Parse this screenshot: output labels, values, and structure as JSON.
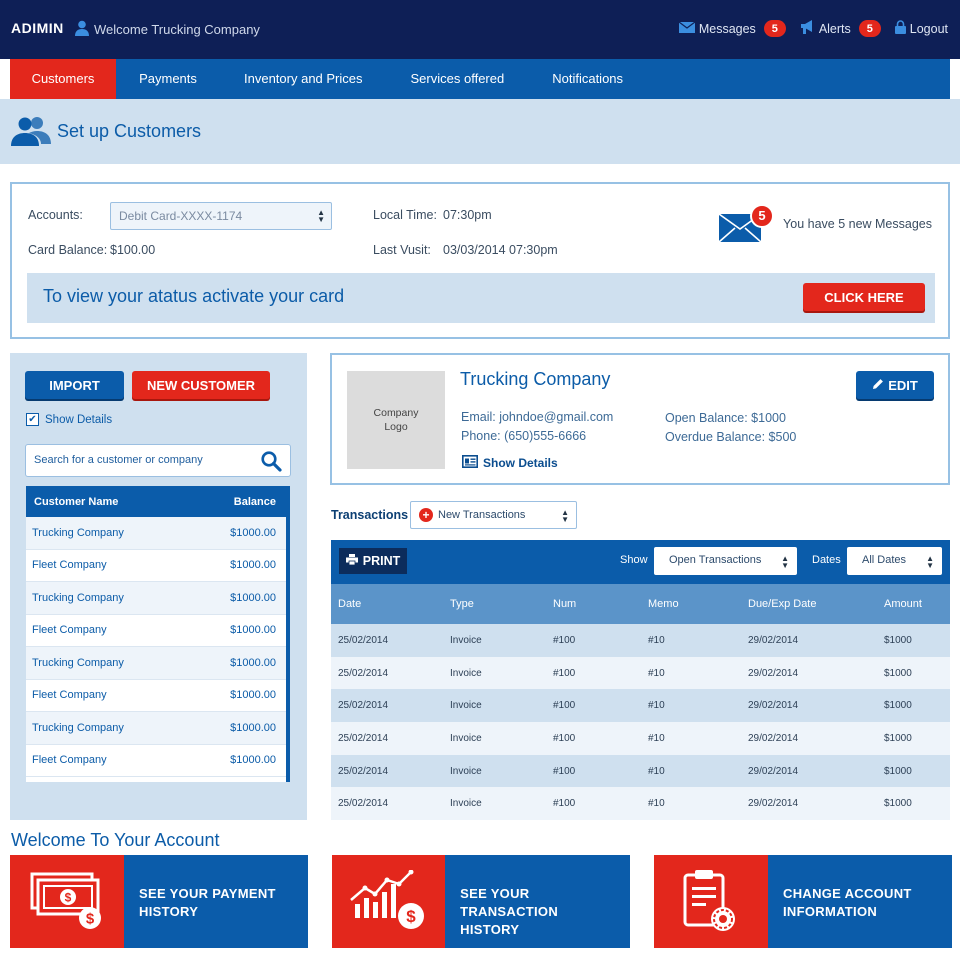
{
  "header": {
    "brand": "ADIMIN",
    "welcome": "Welcome Trucking Company",
    "messages_label": "Messages",
    "messages_count": "5",
    "alerts_label": "Alerts",
    "alerts_count": "5",
    "logout_label": "Logout"
  },
  "nav": {
    "items": [
      {
        "label": "Customers"
      },
      {
        "label": "Payments"
      },
      {
        "label": "Inventory and Prices"
      },
      {
        "label": "Services offered"
      },
      {
        "label": "Notifications"
      }
    ]
  },
  "page": {
    "title": "Set up Customers"
  },
  "account": {
    "accounts_label": "Accounts:",
    "accounts_value": "Debit Card-XXXX-1174",
    "balance_label": "Card Balance:",
    "balance_value": "$100.00",
    "local_time_label": "Local Time:",
    "local_time_value": "07:30pm",
    "last_visit_label": "Last Vusit:",
    "last_visit_value": "03/03/2014 07:30pm",
    "msg_count": "5",
    "msg_text": "You have 5 new Messages",
    "activate_text": "To view your atatus activate your card",
    "click_here": "CLICK HERE"
  },
  "customers": {
    "import_label": "IMPORT",
    "new_label": "NEW CUSTOMER",
    "show_details": "Show Details",
    "search_placeholder": "Search for a customer or company",
    "col_name": "Customer Name",
    "col_balance": "Balance",
    "rows": [
      {
        "name": "Trucking Company",
        "balance": "$1000.00"
      },
      {
        "name": "Fleet Company",
        "balance": "$1000.00"
      },
      {
        "name": "Trucking Company",
        "balance": "$1000.00"
      },
      {
        "name": "Fleet Company",
        "balance": "$1000.00"
      },
      {
        "name": "Trucking Company",
        "balance": "$1000.00"
      },
      {
        "name": "Fleet Company",
        "balance": "$1000.00"
      },
      {
        "name": "Trucking Company",
        "balance": "$1000.00"
      },
      {
        "name": "Fleet Company",
        "balance": "$1000.00"
      }
    ]
  },
  "company": {
    "logo_line1": "Company",
    "logo_line2": "Logo",
    "name": "Trucking Company",
    "email": "Email: johndoe@gmail.com",
    "phone": "Phone: (650)555-6666",
    "open_balance": "Open Balance: $1000",
    "overdue_balance": "Overdue Balance: $500",
    "show_details": "Show Details",
    "edit_label": "EDIT"
  },
  "transactions": {
    "label": "Transactions",
    "new_label": "New Transactions",
    "print_label": "PRINT",
    "show_label": "Show",
    "show_value": "Open Transactions",
    "dates_label": "Dates",
    "dates_value": "All Dates",
    "columns": [
      "Date",
      "Type",
      "Num",
      "Memo",
      "Due/Exp Date",
      "Amount"
    ],
    "rows": [
      [
        "25/02/2014",
        "Invoice",
        "#100",
        "#10",
        "29/02/2014",
        "$1000"
      ],
      [
        "25/02/2014",
        "Invoice",
        "#100",
        "#10",
        "29/02/2014",
        "$1000"
      ],
      [
        "25/02/2014",
        "Invoice",
        "#100",
        "#10",
        "29/02/2014",
        "$1000"
      ],
      [
        "25/02/2014",
        "Invoice",
        "#100",
        "#10",
        "29/02/2014",
        "$1000"
      ],
      [
        "25/02/2014",
        "Invoice",
        "#100",
        "#10",
        "29/02/2014",
        "$1000"
      ],
      [
        "25/02/2014",
        "Invoice",
        "#100",
        "#10",
        "29/02/2014",
        "$1000"
      ]
    ]
  },
  "welcome_section": {
    "title": "Welcome To Your Account",
    "tiles": [
      {
        "line1": "SEE YOUR PAYMENT",
        "line2": "HISTORY",
        "icon": "money-icon"
      },
      {
        "line1": "SEE YOUR TRANSACTION",
        "line2": "HISTORY",
        "icon": "chart-dollar-icon"
      },
      {
        "line1": "CHANGE ACCOUNT",
        "line2": "INFORMATION",
        "icon": "clipboard-gear-icon"
      }
    ]
  },
  "colors": {
    "brand_red": "#e3271c",
    "brand_blue": "#0b5caa",
    "top_navy": "#0e1f56",
    "light_blue": "#cfe0ef"
  }
}
